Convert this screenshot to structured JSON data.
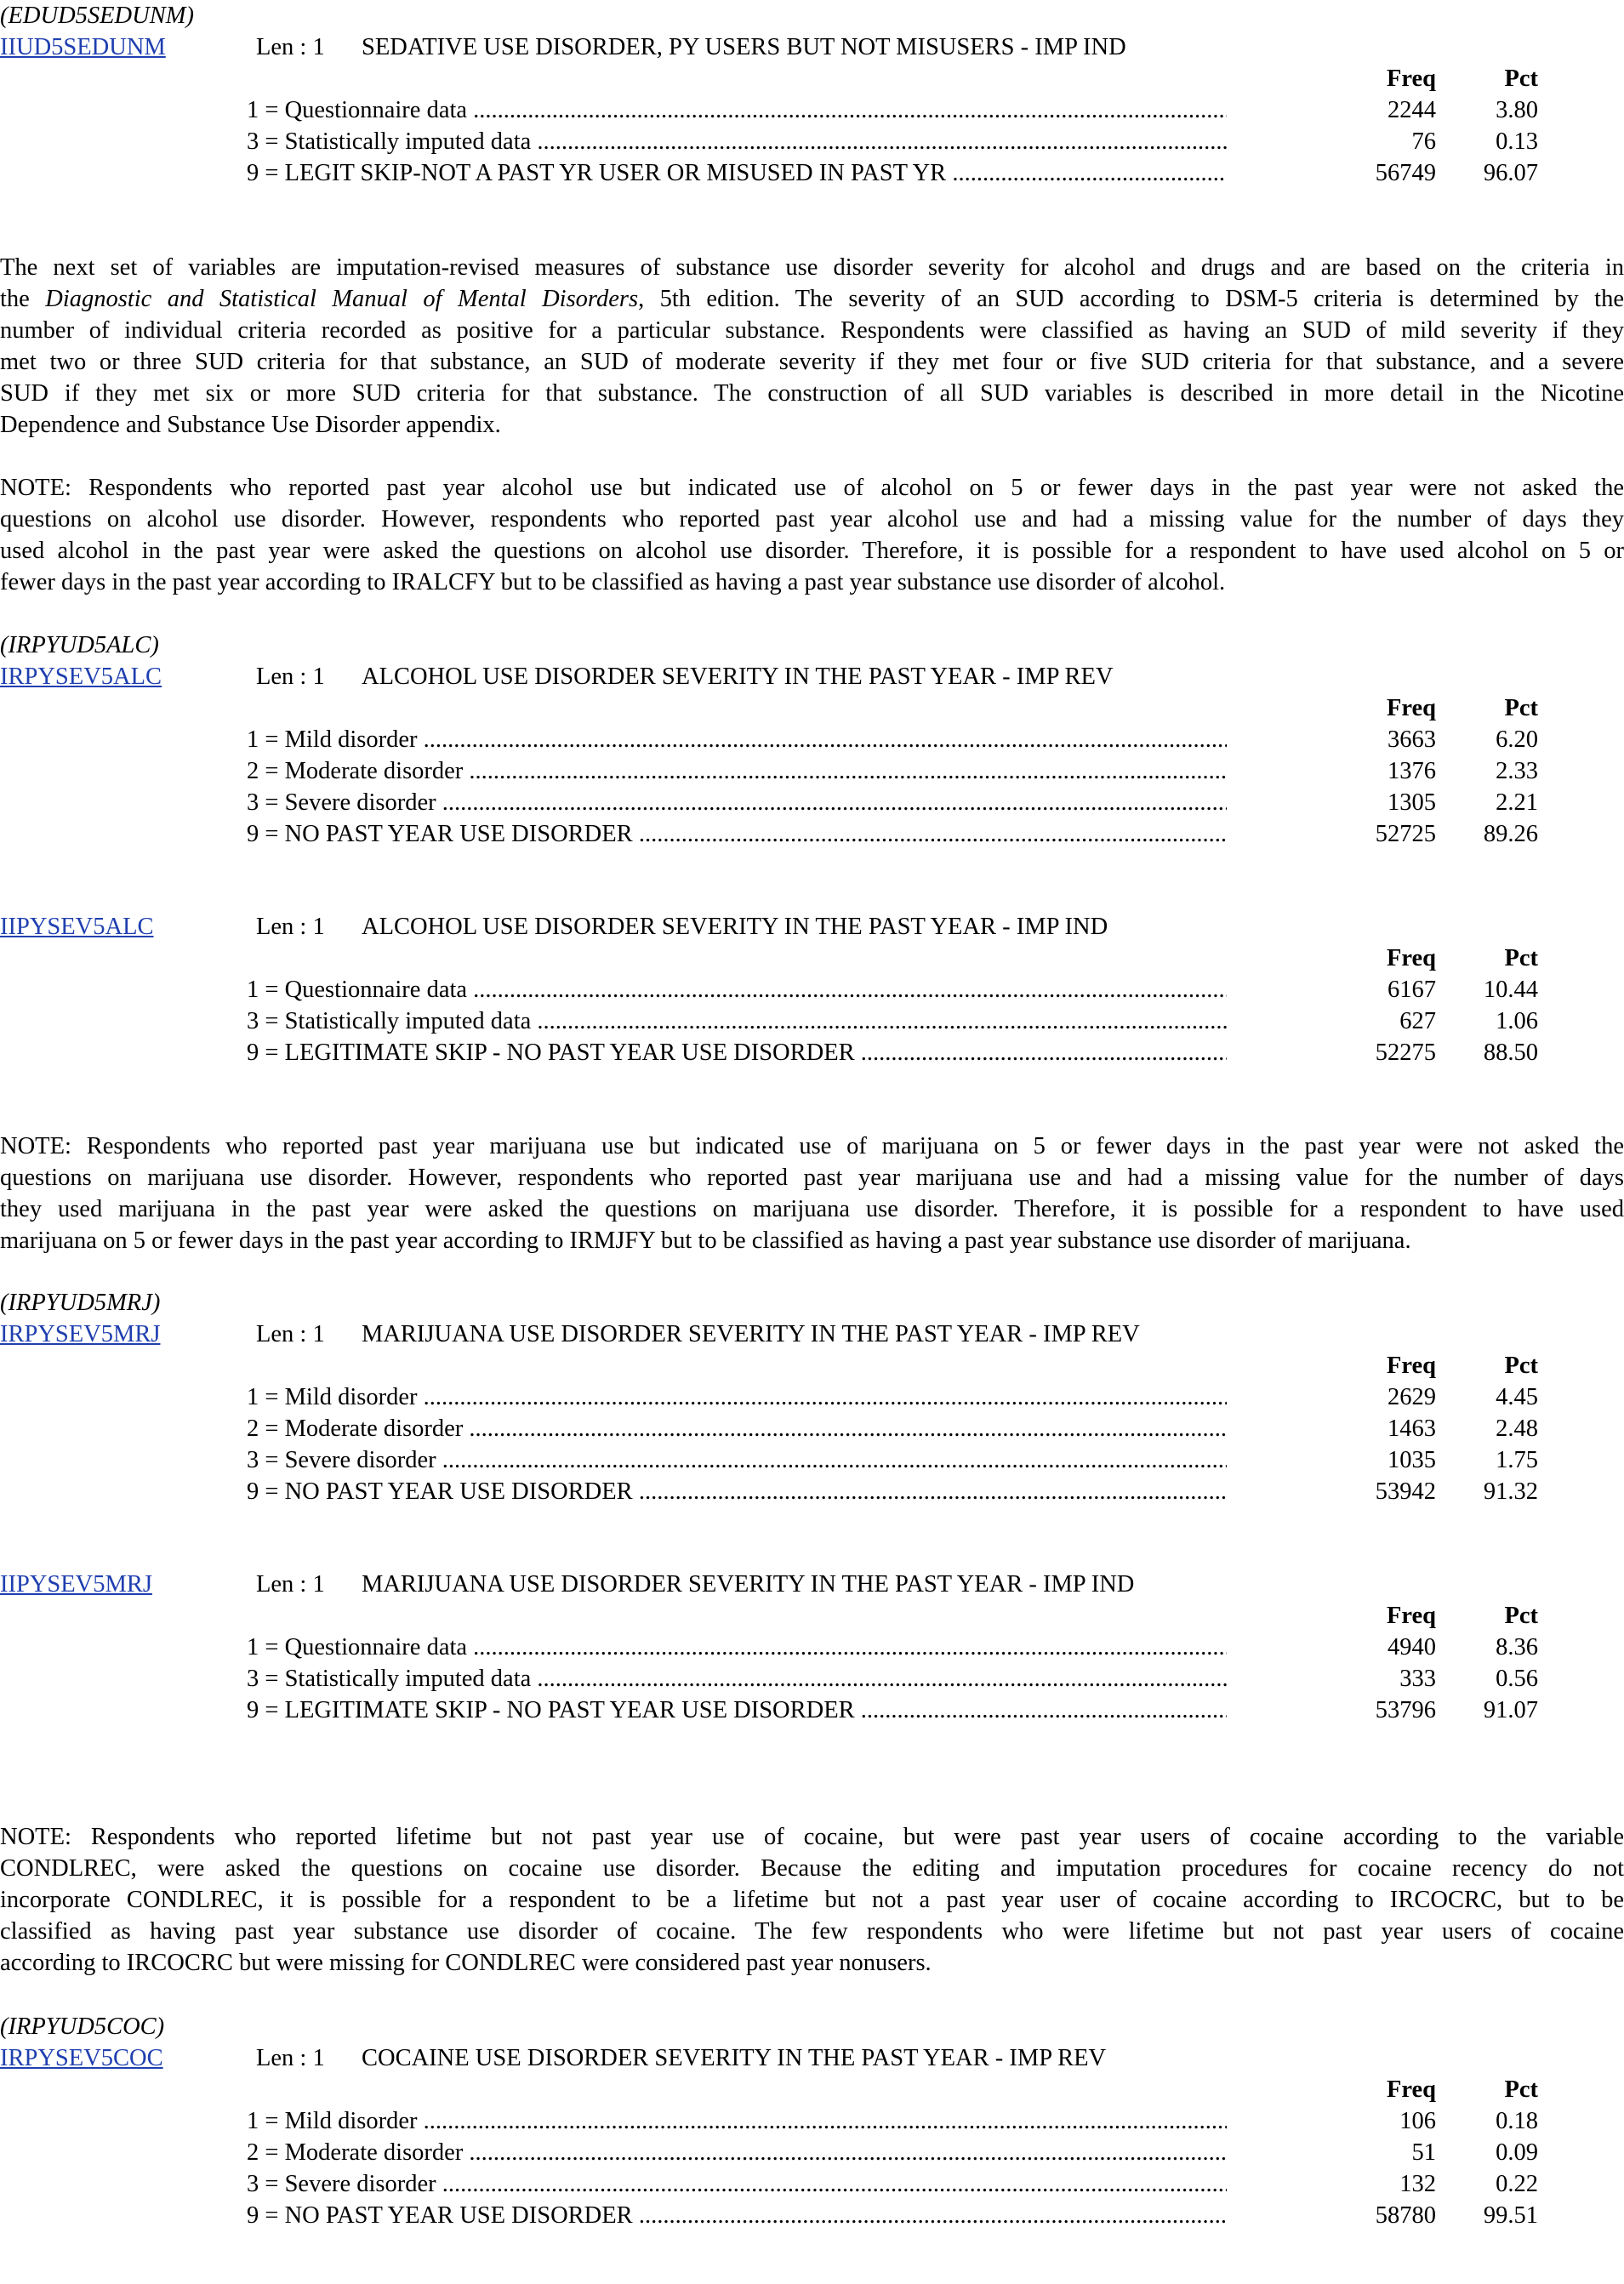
{
  "hdr": {
    "freq": "Freq",
    "pct": "Pct"
  },
  "blocks": [
    {
      "paren": "(EDUD5SEDUNM)",
      "name": "IIUD5SEDUNM",
      "len": "Len : 1",
      "title": "SEDATIVE USE DISORDER, PY USERS BUT NOT MISUSERS - IMP IND",
      "rows": [
        {
          "label": "1 = Questionnaire data",
          "freq": "2244",
          "pct": "3.80"
        },
        {
          "label": "3 = Statistically imputed data",
          "freq": "76",
          "pct": "0.13"
        },
        {
          "label": "9 = LEGIT SKIP-NOT A PAST YR USER OR MISUSED IN PAST YR",
          "freq": "56749",
          "pct": "96.07"
        }
      ]
    },
    {
      "paren": "(IRPYUD5ALC)",
      "name": "IRPYSEV5ALC",
      "len": "Len : 1",
      "title": "ALCOHOL USE DISORDER SEVERITY IN THE PAST YEAR - IMP REV",
      "rows": [
        {
          "label": "1 = Mild disorder",
          "freq": "3663",
          "pct": "6.20"
        },
        {
          "label": "2 = Moderate disorder",
          "freq": "1376",
          "pct": "2.33"
        },
        {
          "label": "3 = Severe disorder",
          "freq": "1305",
          "pct": "2.21"
        },
        {
          "label": "9 = NO PAST YEAR USE DISORDER",
          "freq": "52725",
          "pct": "89.26"
        }
      ]
    },
    {
      "paren": "",
      "name": "IIPYSEV5ALC",
      "len": "Len : 1",
      "title": "ALCOHOL USE DISORDER SEVERITY IN THE PAST YEAR - IMP IND",
      "rows": [
        {
          "label": "1 = Questionnaire data",
          "freq": "6167",
          "pct": "10.44"
        },
        {
          "label": "3 = Statistically imputed data",
          "freq": "627",
          "pct": "1.06"
        },
        {
          "label": "9 = LEGITIMATE SKIP - NO PAST YEAR USE DISORDER",
          "freq": "52275",
          "pct": "88.50"
        }
      ]
    },
    {
      "paren": "(IRPYUD5MRJ)",
      "name": "IRPYSEV5MRJ",
      "len": "Len : 1",
      "title": "MARIJUANA USE DISORDER SEVERITY IN THE PAST YEAR - IMP REV",
      "rows": [
        {
          "label": "1 = Mild disorder",
          "freq": "2629",
          "pct": "4.45"
        },
        {
          "label": "2 = Moderate disorder",
          "freq": "1463",
          "pct": "2.48"
        },
        {
          "label": "3 = Severe disorder",
          "freq": "1035",
          "pct": "1.75"
        },
        {
          "label": "9 = NO PAST YEAR USE DISORDER",
          "freq": "53942",
          "pct": "91.32"
        }
      ]
    },
    {
      "paren": "",
      "name": "IIPYSEV5MRJ",
      "len": "Len : 1",
      "title": "MARIJUANA USE DISORDER SEVERITY IN THE PAST YEAR - IMP IND",
      "rows": [
        {
          "label": "1 = Questionnaire data",
          "freq": "4940",
          "pct": "8.36"
        },
        {
          "label": "3 = Statistically imputed data",
          "freq": "333",
          "pct": "0.56"
        },
        {
          "label": "9 = LEGITIMATE SKIP - NO PAST YEAR USE DISORDER",
          "freq": "53796",
          "pct": "91.07"
        }
      ]
    },
    {
      "paren": "(IRPYUD5COC)",
      "name": "IRPYSEV5COC",
      "len": "Len : 1",
      "title": "COCAINE USE DISORDER SEVERITY IN THE PAST YEAR - IMP REV",
      "rows": [
        {
          "label": "1 = Mild disorder",
          "freq": "106",
          "pct": "0.18"
        },
        {
          "label": "2 = Moderate disorder",
          "freq": "51",
          "pct": "0.09"
        },
        {
          "label": "3 = Severe disorder",
          "freq": "132",
          "pct": "0.22"
        },
        {
          "label": "9 = NO PAST YEAR USE DISORDER",
          "freq": "58780",
          "pct": "99.51"
        }
      ]
    }
  ],
  "paras": {
    "intro": {
      "l1": "The next set of variables are imputation-revised measures of substance use disorder severity for alcohol and drugs and are based on the criteria in",
      "l2a": "the ",
      "l2em": "Diagnostic and Statistical Manual of Mental Disorders",
      "l2b": ", 5th edition. The severity of an SUD according to DSM-5 criteria is determined by the",
      "l3": "number of individual criteria recorded as positive for a particular substance. Respondents were classified as having an SUD of mild severity if they",
      "l4": "met two or three SUD criteria for that substance, an SUD of moderate severity if they met four or five SUD criteria for that substance, and a severe",
      "l5": "SUD if they met six or more SUD criteria for that substance. The construction of all SUD variables is described in more detail in the Nicotine",
      "l6": "Dependence and Substance Use Disorder appendix."
    },
    "note_alc": {
      "l1": "NOTE: Respondents who reported past year alcohol use but indicated use of alcohol on 5 or fewer days in the past year were not asked the",
      "l2": "questions on alcohol use disorder. However, respondents who reported past year alcohol use and had a missing value for the number of days they",
      "l3": "used alcohol in the past year were asked the questions on alcohol use disorder. Therefore, it is possible for a respondent to have used alcohol on 5 or",
      "l4": "fewer days in the past year according to IRALCFY but to be classified as having a past year substance use disorder of alcohol."
    },
    "note_mrj": {
      "l1": "NOTE: Respondents who reported past year marijuana use but indicated use of marijuana on 5 or fewer days in the past year were not asked the",
      "l2": "questions on marijuana use disorder. However, respondents who reported past year marijuana use and had a missing value for the number of days",
      "l3": "they used marijuana in the past year were asked the questions on marijuana use disorder. Therefore, it is possible for a respondent to have used",
      "l4": "marijuana on 5 or fewer days in the past year according to IRMJFY but to be classified as having a past year substance use disorder of marijuana."
    },
    "note_coc": {
      "l1": "NOTE: Respondents who reported lifetime but not past year use of cocaine, but were past year users of cocaine according to the variable",
      "l2": "CONDLREC, were asked the questions on cocaine use disorder. Because the editing and imputation procedures for cocaine recency do not",
      "l3": "incorporate CONDLREC, it is possible for a respondent to be a lifetime but not a past year user of cocaine according to IRCOCRC, but to be",
      "l4": "classified as having past year substance use disorder of cocaine. The few respondents who were lifetime but not past year users of cocaine",
      "l5": "according to IRCOCRC but were missing for CONDLREC were considered past year nonusers."
    }
  }
}
